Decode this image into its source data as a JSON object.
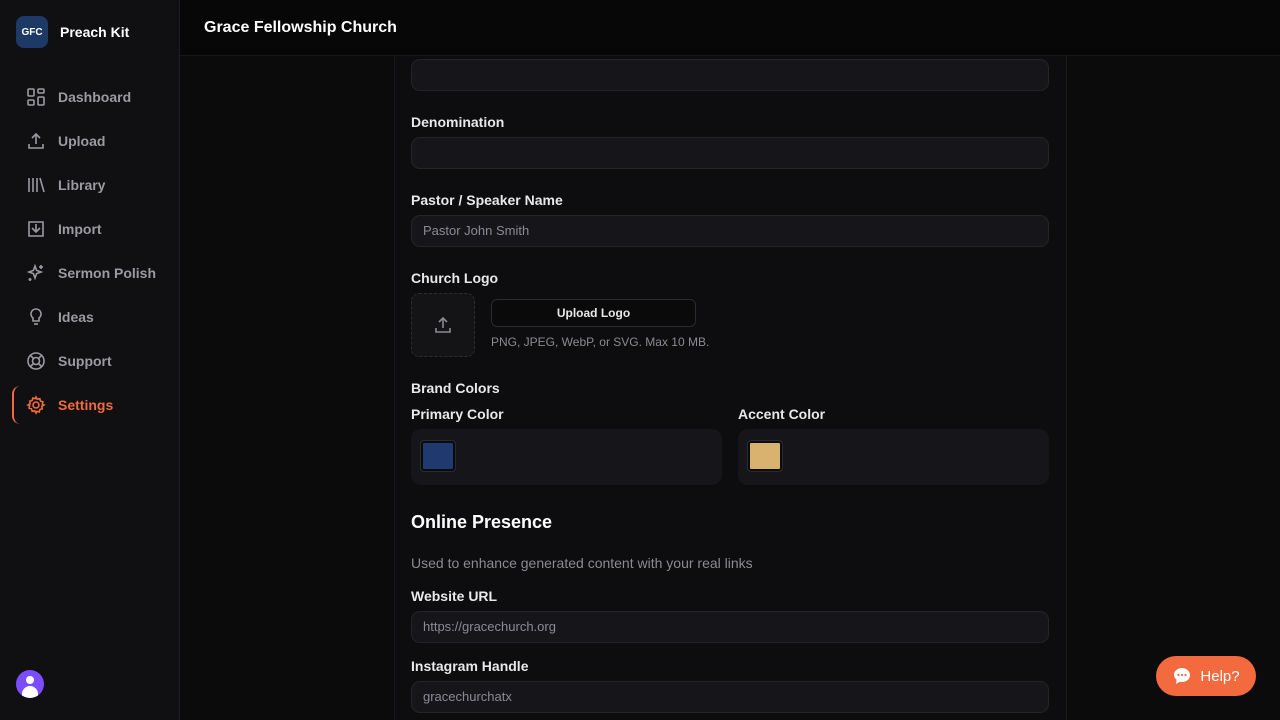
{
  "app": {
    "logo_text": "GFC",
    "name": "Preach Kit"
  },
  "header": {
    "title": "Grace Fellowship Church"
  },
  "sidebar": {
    "items": [
      {
        "label": "Dashboard",
        "icon": "grid-icon"
      },
      {
        "label": "Upload",
        "icon": "upload-icon"
      },
      {
        "label": "Library",
        "icon": "library-icon"
      },
      {
        "label": "Import",
        "icon": "import-icon"
      },
      {
        "label": "Sermon Polish",
        "icon": "sparkles-icon"
      },
      {
        "label": "Ideas",
        "icon": "lightbulb-icon"
      },
      {
        "label": "Support",
        "icon": "lifebuoy-icon"
      },
      {
        "label": "Settings",
        "icon": "gear-icon",
        "active": true
      }
    ]
  },
  "form": {
    "church_name_value": "",
    "denomination_label": "Denomination",
    "denomination_value": "",
    "pastor_label": "Pastor / Speaker Name",
    "pastor_placeholder": "Pastor John Smith",
    "logo_label": "Church Logo",
    "upload_logo_button": "Upload Logo",
    "upload_hint": "PNG, JPEG, WebP, or SVG. Max 10 MB.",
    "brand_colors_label": "Brand Colors",
    "primary_color_label": "Primary Color",
    "primary_color": "#1e3a6e",
    "accent_color_label": "Accent Color",
    "accent_color": "#d8b26e"
  },
  "online_presence": {
    "title": "Online Presence",
    "subtitle": "Used to enhance generated content with your real links",
    "website_label": "Website URL",
    "website_placeholder": "https://gracechurch.org",
    "instagram_label": "Instagram Handle",
    "instagram_placeholder": "gracechurchatx"
  },
  "help": {
    "label": "Help?"
  },
  "colors": {
    "accent": "#f26a3d"
  }
}
